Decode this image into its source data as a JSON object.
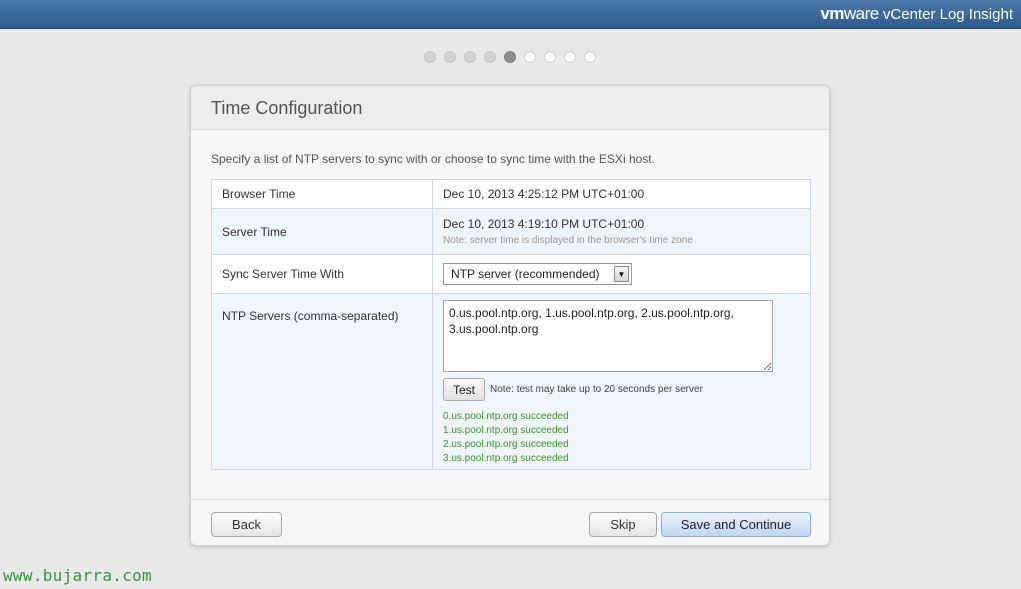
{
  "header": {
    "brand_vm": "vm",
    "brand_ware": "ware",
    "product": " vCenter Log Insight"
  },
  "steps": {
    "total": 9,
    "current": 5
  },
  "dialog": {
    "title": "Time Configuration",
    "intro": "Specify a list of NTP servers to sync with or choose to sync time with the ESXi host.",
    "rows": {
      "browser_time": {
        "label": "Browser Time",
        "value": "Dec 10, 2013 4:25:12 PM UTC+01:00"
      },
      "server_time": {
        "label": "Server Time",
        "value": "Dec 10, 2013 4:19:10 PM UTC+01:00",
        "note": "Note: server time is displayed in the browser's time zone"
      },
      "sync_with": {
        "label": "Sync Server Time With",
        "selected": "NTP server (recommended)"
      },
      "ntp_servers": {
        "label": "NTP Servers (comma-separated)",
        "value": "0.us.pool.ntp.org, 1.us.pool.ntp.org, 2.us.pool.ntp.org, 3.us.pool.ntp.org",
        "test_label": "Test",
        "test_note": "Note: test may take up to 20 seconds per server",
        "results": [
          "0.us.pool.ntp.org succeeded",
          "1.us.pool.ntp.org succeeded",
          "2.us.pool.ntp.org succeeded",
          "3.us.pool.ntp.org succeeded"
        ]
      }
    },
    "footer": {
      "back_label": "Back",
      "skip_label": "Skip",
      "save_label": "Save and Continue"
    }
  },
  "watermark": "www.bujarra.com",
  "colors": {
    "header_bar": "#3b6a9b",
    "success_text": "#3a9a1e",
    "watermark": "#2e9a3a",
    "primary_button": "#bfd8f1"
  }
}
